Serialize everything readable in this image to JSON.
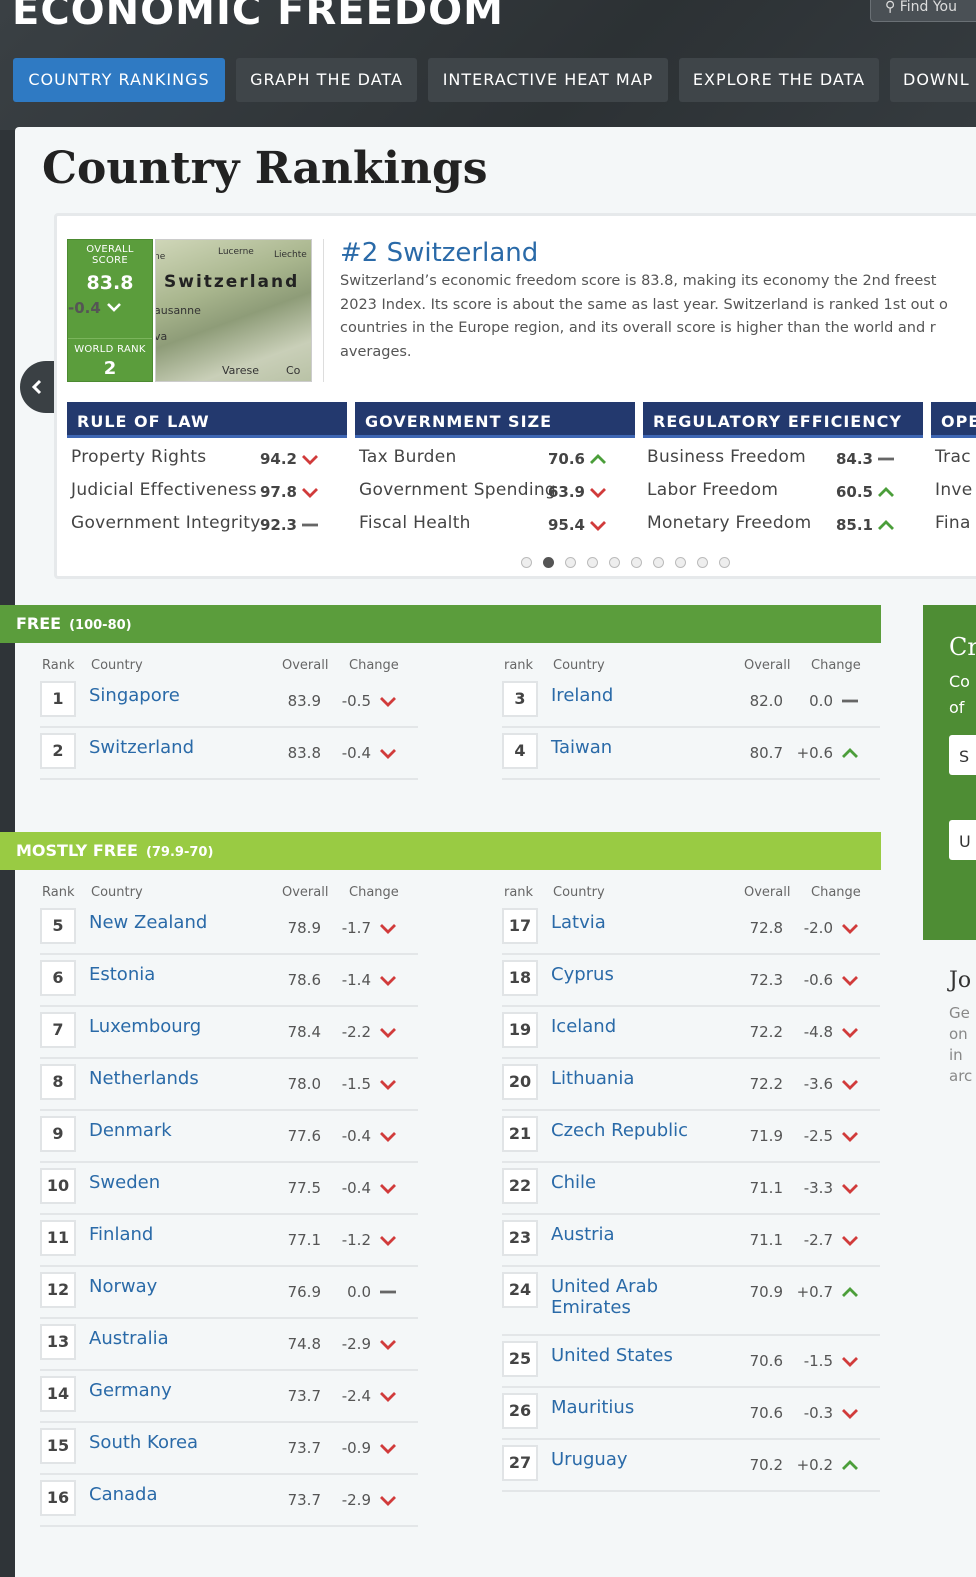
{
  "header": {
    "brand": "ECONOMIC FREEDOM",
    "search_placeholder": "Find You",
    "nav": [
      "COUNTRY RANKINGS",
      "GRAPH THE DATA",
      "INTERACTIVE HEAT MAP",
      "EXPLORE THE DATA",
      "DOWNL"
    ]
  },
  "page": {
    "title": "Country Rankings"
  },
  "featured": {
    "overall_score_label": "OVERALL SCORE",
    "overall_score": "83.8",
    "change": "-0.4",
    "world_rank_label": "WORLD RANK",
    "world_rank": "2",
    "map_labels": {
      "lucerne": "Lucerne",
      "liechte": "Liechte",
      "ne": "ne",
      "switzerland": "Switzerland",
      "ausanne": "ausanne",
      "va": "va",
      "varese": "Varese",
      "co": "Co"
    },
    "title": "#2 Switzerland",
    "desc_lines": [
      "Switzerland’s economic freedom score is 83.8, making its economy the 2nd freest",
      "2023 Index. Its score is about the same as last year. Switzerland is ranked 1st out o",
      "countries in the Europe region, and its overall score is higher than the world and r",
      "averages."
    ],
    "categories": [
      {
        "name": "RULE OF LAW",
        "factors": [
          {
            "label": "Property Rights",
            "value": "94.2",
            "trend": "down"
          },
          {
            "label": "Judicial Effectiveness",
            "value": "97.8",
            "trend": "down"
          },
          {
            "label": "Government Integrity",
            "value": "92.3",
            "trend": "flat"
          }
        ]
      },
      {
        "name": "GOVERNMENT SIZE",
        "factors": [
          {
            "label": "Tax Burden",
            "value": "70.6",
            "trend": "up"
          },
          {
            "label": "Government Spending",
            "value": "63.9",
            "trend": "down"
          },
          {
            "label": "Fiscal Health",
            "value": "95.4",
            "trend": "down"
          }
        ]
      },
      {
        "name": "REGULATORY EFFICIENCY",
        "factors": [
          {
            "label": "Business Freedom",
            "value": "84.3",
            "trend": "flat"
          },
          {
            "label": "Labor Freedom",
            "value": "60.5",
            "trend": "up"
          },
          {
            "label": "Monetary Freedom",
            "value": "85.1",
            "trend": "up"
          }
        ]
      },
      {
        "name": "OPE",
        "factors": [
          {
            "label": "Trac",
            "value": "",
            "trend": ""
          },
          {
            "label": "Inve",
            "value": "",
            "trend": ""
          },
          {
            "label": "Fina",
            "value": "",
            "trend": ""
          }
        ]
      }
    ],
    "carousel_active": 2,
    "carousel_count": 10
  },
  "columns": {
    "rank_left": "Rank",
    "rank_right": "rank",
    "country": "Country",
    "overall": "Overall",
    "change": "Change"
  },
  "colors": {
    "free": "#5b9d3c",
    "mostly_free": "#99cb43",
    "down": "#d13b3b",
    "up": "#4b9e3a",
    "flat": "#666666",
    "link": "#2a6aa8"
  },
  "groups": [
    {
      "name": "FREE",
      "range": "(100-80)",
      "left": [
        {
          "rank": "1",
          "country": "Singapore",
          "overall": "83.9",
          "change": "-0.5",
          "trend": "down"
        },
        {
          "rank": "2",
          "country": "Switzerland",
          "overall": "83.8",
          "change": "-0.4",
          "trend": "down"
        }
      ],
      "right": [
        {
          "rank": "3",
          "country": "Ireland",
          "overall": "82.0",
          "change": "0.0",
          "trend": "flat"
        },
        {
          "rank": "4",
          "country": "Taiwan",
          "overall": "80.7",
          "change": "+0.6",
          "trend": "up"
        }
      ]
    },
    {
      "name": "MOSTLY FREE",
      "range": "(79.9-70)",
      "left": [
        {
          "rank": "5",
          "country": "New Zealand",
          "overall": "78.9",
          "change": "-1.7",
          "trend": "down"
        },
        {
          "rank": "6",
          "country": "Estonia",
          "overall": "78.6",
          "change": "-1.4",
          "trend": "down"
        },
        {
          "rank": "7",
          "country": "Luxembourg",
          "overall": "78.4",
          "change": "-2.2",
          "trend": "down"
        },
        {
          "rank": "8",
          "country": "Netherlands",
          "overall": "78.0",
          "change": "-1.5",
          "trend": "down"
        },
        {
          "rank": "9",
          "country": "Denmark",
          "overall": "77.6",
          "change": "-0.4",
          "trend": "down"
        },
        {
          "rank": "10",
          "country": "Sweden",
          "overall": "77.5",
          "change": "-0.4",
          "trend": "down"
        },
        {
          "rank": "11",
          "country": "Finland",
          "overall": "77.1",
          "change": "-1.2",
          "trend": "down"
        },
        {
          "rank": "12",
          "country": "Norway",
          "overall": "76.9",
          "change": "0.0",
          "trend": "flat"
        },
        {
          "rank": "13",
          "country": "Australia",
          "overall": "74.8",
          "change": "-2.9",
          "trend": "down"
        },
        {
          "rank": "14",
          "country": "Germany",
          "overall": "73.7",
          "change": "-2.4",
          "trend": "down"
        },
        {
          "rank": "15",
          "country": "South Korea",
          "overall": "73.7",
          "change": "-0.9",
          "trend": "down"
        },
        {
          "rank": "16",
          "country": "Canada",
          "overall": "73.7",
          "change": "-2.9",
          "trend": "down"
        }
      ],
      "right": [
        {
          "rank": "17",
          "country": "Latvia",
          "overall": "72.8",
          "change": "-2.0",
          "trend": "down"
        },
        {
          "rank": "18",
          "country": "Cyprus",
          "overall": "72.3",
          "change": "-0.6",
          "trend": "down"
        },
        {
          "rank": "19",
          "country": "Iceland",
          "overall": "72.2",
          "change": "-4.8",
          "trend": "down"
        },
        {
          "rank": "20",
          "country": "Lithuania",
          "overall": "72.2",
          "change": "-3.6",
          "trend": "down"
        },
        {
          "rank": "21",
          "country": "Czech Republic",
          "overall": "71.9",
          "change": "-2.5",
          "trend": "down"
        },
        {
          "rank": "22",
          "country": "Chile",
          "overall": "71.1",
          "change": "-3.3",
          "trend": "down"
        },
        {
          "rank": "23",
          "country": "Austria",
          "overall": "71.1",
          "change": "-2.7",
          "trend": "down"
        },
        {
          "rank": "24",
          "country": "United Arab\nEmirates",
          "overall": "70.9",
          "change": "+0.7",
          "trend": "up"
        },
        {
          "rank": "25",
          "country": "United States",
          "overall": "70.6",
          "change": "-1.5",
          "trend": "down"
        },
        {
          "rank": "26",
          "country": "Mauritius",
          "overall": "70.6",
          "change": "-0.3",
          "trend": "down"
        },
        {
          "rank": "27",
          "country": "Uruguay",
          "overall": "70.2",
          "change": "+0.2",
          "trend": "up"
        }
      ]
    }
  ],
  "sidebar": {
    "box_title": "Cr",
    "box_lines": [
      "Co",
      "of"
    ],
    "inputs": [
      "S",
      "U"
    ],
    "join_title": "Jo",
    "join_lines": [
      "Ge",
      "on",
      "in",
      "arc"
    ]
  }
}
